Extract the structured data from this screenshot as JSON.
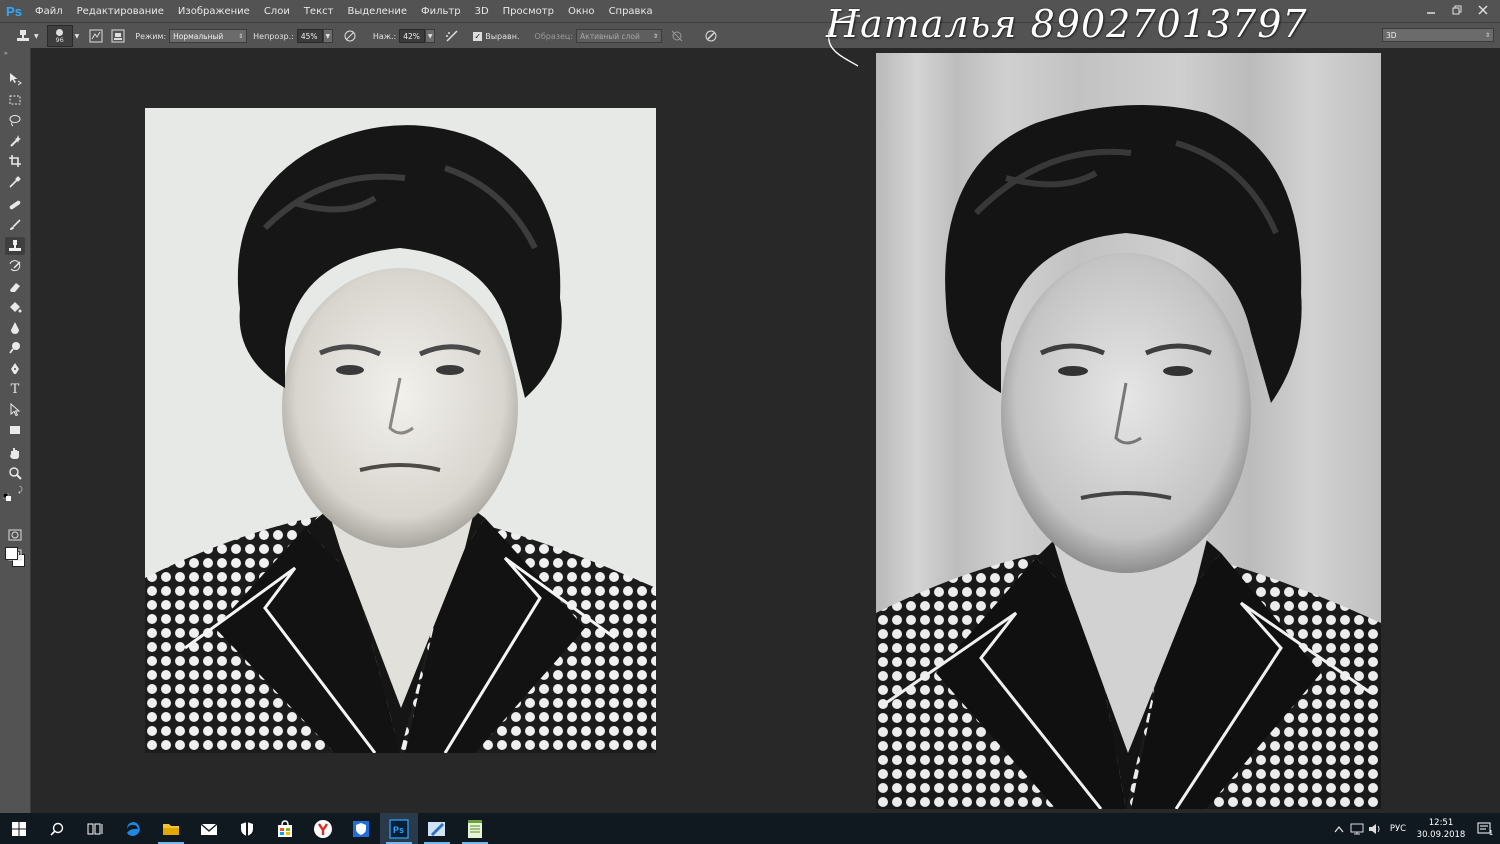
{
  "app": {
    "logo": "Ps",
    "menu": [
      "Файл",
      "Редактирование",
      "Изображение",
      "Слои",
      "Текст",
      "Выделение",
      "Фильтр",
      "3D",
      "Просмотр",
      "Окно",
      "Справка"
    ],
    "window_controls": [
      "minimize-icon",
      "restore-icon",
      "close-icon"
    ]
  },
  "watermark": "Наталья 89027013797",
  "options": {
    "brush_size": "96",
    "mode_label": "Режим:",
    "mode_value": "Нормальный",
    "opacity_label": "Непрозр.:",
    "opacity_value": "45%",
    "pressure_label": "Наж.:",
    "pressure_value": "42%",
    "aligned_label": "Выравн.",
    "aligned_checked": true,
    "sample_label": "Образец:",
    "sample_value": "Активный слой",
    "workspace": "3D"
  },
  "tools": [
    "move-tool",
    "marquee-tool",
    "lasso-tool",
    "magic-wand-tool",
    "crop-tool",
    "eyedropper-tool",
    "healing-brush-tool",
    "brush-tool",
    "clone-stamp-tool",
    "history-brush-tool",
    "eraser-tool",
    "paint-bucket-tool",
    "blur-tool",
    "dodge-tool",
    "pen-tool",
    "type-tool",
    "path-selection-tool",
    "rectangle-tool",
    "hand-tool",
    "zoom-tool"
  ],
  "active_tool": "clone-stamp-tool",
  "colors": {
    "foreground": "#ffffff",
    "background": "#ffffff",
    "accent": "#31a8ff"
  },
  "taskbar": {
    "apps": [
      "start-icon",
      "search-icon",
      "task-view-icon",
      "edge-icon",
      "file-explorer-icon",
      "mail-icon",
      "security-shield-icon",
      "store-icon",
      "yandex-browser-icon",
      "defender-icon",
      "photoshop-icon",
      "pen-app-icon",
      "notepad-icon"
    ],
    "active_app": "photoshop-icon",
    "language": "РУС",
    "time": "12:51",
    "date": "30.09.2018",
    "notification_count": "1"
  }
}
